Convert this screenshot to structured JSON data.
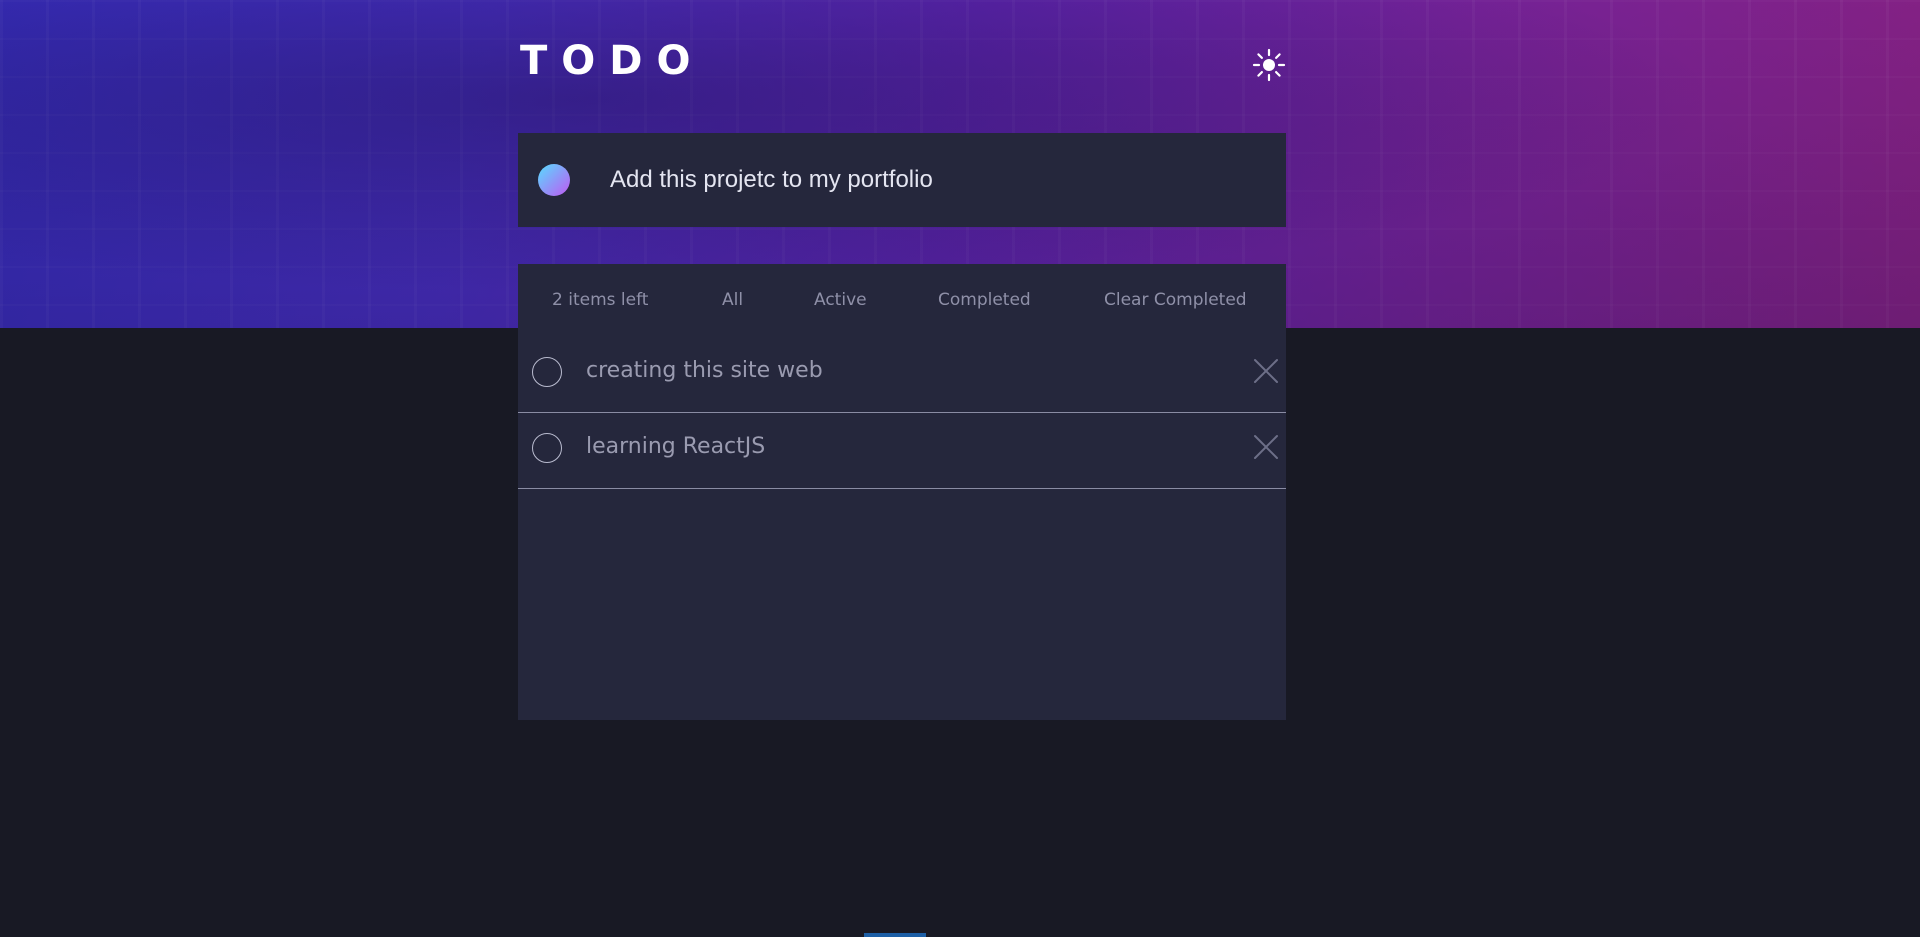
{
  "app": {
    "title": "TODO",
    "theme_icon": "sun-icon"
  },
  "new_todo": {
    "value": "Add this projetc to my portfolio"
  },
  "filters": {
    "items_left": "2 items left",
    "all": "All",
    "active": "Active",
    "completed": "Completed",
    "clear_completed": "Clear Completed"
  },
  "todos": [
    {
      "text": "creating this site web",
      "completed": false
    },
    {
      "text": "learning ReactJS",
      "completed": false
    }
  ],
  "colors": {
    "background": "#181924",
    "card": "#25273c",
    "accent_gradient_start": "#57ddff",
    "accent_gradient_end": "#c058f3",
    "muted_text": "#8f90a8"
  }
}
